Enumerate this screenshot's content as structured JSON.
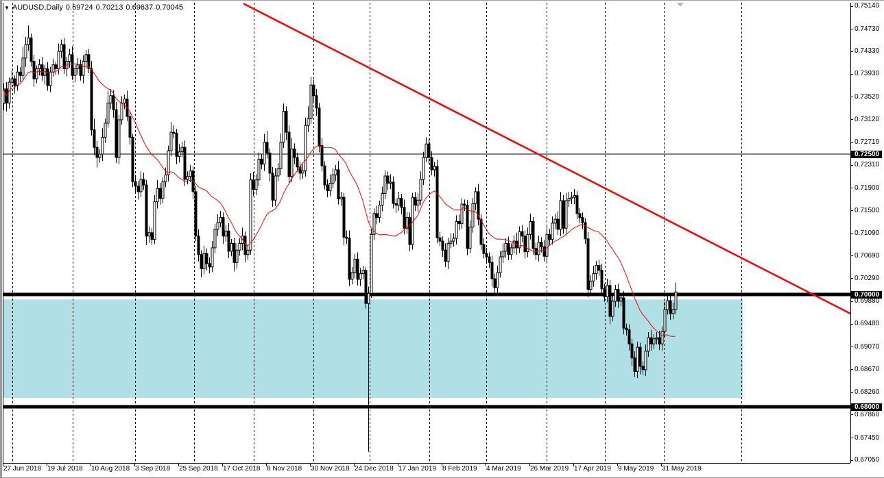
{
  "header": {
    "symbol": "AUDUSD,Daily",
    "open": "0.69724",
    "high": "0.70213",
    "low": "0.69637",
    "close": "0.70045"
  },
  "colors": {
    "bull_body": "#ffffff",
    "bear_body": "#000000",
    "moving_average": "#ff0000",
    "trendline": "#ff0000",
    "zone_fill": "#b0dfe5",
    "level_line": "#000000"
  },
  "chart_data": {
    "type": "candlestick",
    "title": "AUDUSD,Daily",
    "ylim": [
      0.6705,
      0.7514
    ],
    "price_ticks": [
      "0.75140",
      "0.74730",
      "0.74330",
      "0.73930",
      "0.73520",
      "0.73120",
      "0.72710",
      "0.72310",
      "0.71900",
      "0.71500",
      "0.71090",
      "0.70690",
      "0.70290",
      "0.69880",
      "0.69480",
      "0.69070",
      "0.68670",
      "0.68260",
      "0.67860",
      "0.67450",
      "0.67050"
    ],
    "highlighted_levels": [
      {
        "label": "0.72500",
        "price": 0.725,
        "weight": "thin"
      },
      {
        "label": "0.70000",
        "price": 0.7,
        "weight": "thick"
      },
      {
        "label": "0.68000",
        "price": 0.68,
        "weight": "thick"
      }
    ],
    "x_tick_labels": [
      "27 Jun 2018",
      "19 Jul 2018",
      "10 Aug 2018",
      "3 Sep 2018",
      "25 Sep 2018",
      "17 Oct 2018",
      "8 Nov 2018",
      "30 Nov 2018",
      "24 Dec 2018",
      "17 Jan 2019",
      "8 Feb 2019",
      "4 Mar 2019",
      "26 Mar 2019",
      "17 Apr 2019",
      "9 May 2019",
      "31 May 2019"
    ],
    "x_tick_bar_step": 16,
    "first_open": 0.734,
    "close": [
      0.7366,
      0.7341,
      0.7378,
      0.7384,
      0.7372,
      0.7396,
      0.739,
      0.7421,
      0.7445,
      0.7457,
      0.7415,
      0.7384,
      0.7402,
      0.7409,
      0.739,
      0.7402,
      0.7372,
      0.7396,
      0.7409,
      0.7402,
      0.7433,
      0.7445,
      0.7402,
      0.7415,
      0.7427,
      0.739,
      0.7402,
      0.7409,
      0.739,
      0.7415,
      0.7427,
      0.7402,
      0.7293,
      0.7262,
      0.7244,
      0.725,
      0.728,
      0.7305,
      0.7341,
      0.7354,
      0.7329,
      0.7244,
      0.7311,
      0.7341,
      0.7348,
      0.7317,
      0.728,
      0.7201,
      0.7193,
      0.7183,
      0.7205,
      0.7195,
      0.7104,
      0.711,
      0.7098,
      0.7165,
      0.7189,
      0.7171,
      0.7201,
      0.7213,
      0.7256,
      0.7289,
      0.7287,
      0.7246,
      0.7254,
      0.7262,
      0.7205,
      0.721,
      0.722,
      0.7183,
      0.7104,
      0.7071,
      0.7046,
      0.7073,
      0.7055,
      0.7049,
      0.7083,
      0.7116,
      0.7128,
      0.7137,
      0.7104,
      0.7113,
      0.7077,
      0.7091,
      0.7057,
      0.7079,
      0.7091,
      0.7104,
      0.7071,
      0.7079,
      0.7204,
      0.7187,
      0.7204,
      0.7241,
      0.7232,
      0.7271,
      0.7252,
      0.7216,
      0.7168,
      0.7211,
      0.7224,
      0.7271,
      0.7326,
      0.7289,
      0.721,
      0.7259,
      0.7244,
      0.7227,
      0.7216,
      0.722,
      0.7301,
      0.7313,
      0.7373,
      0.7354,
      0.7332,
      0.7265,
      0.7229,
      0.7195,
      0.7185,
      0.7198,
      0.7213,
      0.7222,
      0.717,
      0.7173,
      0.7102,
      0.71,
      0.7027,
      0.7039,
      0.7063,
      0.7027,
      0.7037,
      0.7043,
      0.6984,
      0.7002,
      0.7107,
      0.7144,
      0.7137,
      0.7159,
      0.718,
      0.7211,
      0.7198,
      0.72,
      0.7162,
      0.7159,
      0.7171,
      0.7155,
      0.7118,
      0.7137,
      0.7089,
      0.7173,
      0.7159,
      0.7168,
      0.7205,
      0.7244,
      0.7268,
      0.7244,
      0.7222,
      0.7228,
      0.7101,
      0.7095,
      0.7079,
      0.7059,
      0.7091,
      0.7095,
      0.71,
      0.713,
      0.7126,
      0.7161,
      0.7159,
      0.7082,
      0.712,
      0.7162,
      0.7183,
      0.7134,
      0.7089,
      0.7073,
      0.7067,
      0.7057,
      0.7028,
      0.7012,
      0.7039,
      0.7067,
      0.7077,
      0.7091,
      0.7071,
      0.7083,
      0.7095,
      0.7083,
      0.7112,
      0.7104,
      0.7076,
      0.7107,
      0.713,
      0.7082,
      0.7071,
      0.7093,
      0.7085,
      0.7068,
      0.7107,
      0.7098,
      0.7127,
      0.7134,
      0.7116,
      0.7167,
      0.7118,
      0.7167,
      0.7171,
      0.7173,
      0.7176,
      0.7144,
      0.7137,
      0.7128,
      0.7099,
      0.7009,
      0.7024,
      0.7037,
      0.7052,
      0.7043,
      0.701,
      0.6996,
      0.7016,
      0.6961,
      0.6988,
      0.7009,
      0.6988,
      0.6994,
      0.694,
      0.6937,
      0.6912,
      0.6887,
      0.6863,
      0.6906,
      0.6872,
      0.6866,
      0.6899,
      0.6923,
      0.6912,
      0.6921,
      0.6923,
      0.6912,
      0.6934,
      0.6973,
      0.6989,
      0.6966,
      0.6973,
      0.70045
    ],
    "wick_up_pips": [
      10,
      12,
      8,
      15,
      6,
      12,
      9,
      20,
      14,
      22,
      8,
      12,
      6,
      10,
      14,
      7,
      12,
      9,
      11,
      6,
      14,
      9,
      12,
      8,
      10,
      15,
      7,
      12,
      9,
      11,
      8,
      10,
      14,
      20,
      12,
      9,
      16,
      8,
      22,
      12,
      10,
      14,
      9,
      12,
      8,
      15,
      10,
      6,
      12,
      9,
      14,
      12,
      9,
      11,
      8,
      12,
      15,
      10,
      7,
      13,
      9,
      18,
      12,
      8,
      14,
      10,
      12,
      9,
      11,
      8,
      10,
      12,
      8,
      14,
      9,
      11,
      12,
      10,
      15,
      12,
      9,
      11,
      14,
      8,
      10,
      12,
      9,
      15,
      8,
      10,
      12,
      14,
      10,
      12,
      9,
      15,
      20,
      8,
      11,
      14,
      10,
      16,
      14,
      9,
      12,
      20,
      10,
      8,
      9,
      12,
      14,
      22,
      15,
      10,
      12,
      9,
      14,
      8,
      10,
      16,
      12,
      9,
      16,
      10,
      8,
      12,
      14,
      10,
      9,
      12,
      10,
      8,
      6,
      12,
      10,
      9,
      14,
      8,
      12,
      10,
      8,
      14,
      10,
      9,
      12,
      8,
      14,
      10,
      9,
      8,
      10,
      12,
      14,
      10,
      12,
      9,
      11,
      8,
      12,
      10,
      8,
      12,
      10,
      14,
      9,
      11,
      12,
      10,
      8,
      9,
      12,
      10,
      8,
      14,
      9,
      11,
      10,
      8,
      12,
      9,
      12,
      10,
      14,
      9,
      12,
      8,
      10,
      15,
      9,
      12,
      10,
      12,
      14,
      8,
      10,
      12,
      9,
      12,
      14,
      10,
      12,
      10,
      14,
      16,
      10,
      14,
      12,
      10,
      12,
      8,
      10,
      9,
      8,
      12,
      10,
      14,
      8,
      10,
      12,
      9,
      12,
      10,
      14,
      8,
      10,
      9,
      12,
      8,
      10,
      9,
      12,
      10,
      8,
      9,
      12,
      10,
      14,
      8,
      10,
      12,
      9,
      14,
      12,
      10,
      12,
      16.8
    ],
    "wick_down_pips": [
      12,
      15,
      10,
      8,
      14,
      9,
      12,
      10,
      16,
      11,
      9,
      14,
      8,
      12,
      10,
      16,
      9,
      12,
      8,
      11,
      10,
      12,
      9,
      14,
      11,
      8,
      12,
      10,
      9,
      14,
      12,
      8,
      10,
      14,
      18,
      9,
      12,
      10,
      8,
      11,
      14,
      10,
      12,
      9,
      11,
      8,
      13,
      10,
      12,
      14,
      10,
      9,
      16,
      12,
      10,
      8,
      12,
      11,
      9,
      10,
      12,
      10,
      9,
      14,
      11,
      10,
      12,
      9,
      10,
      13,
      9,
      12,
      15,
      10,
      12,
      11,
      9,
      10,
      12,
      8,
      14,
      10,
      12,
      9,
      16,
      11,
      10,
      12,
      14,
      9,
      8,
      12,
      10,
      11,
      9,
      12,
      10,
      14,
      12,
      10,
      9,
      12,
      10,
      14,
      11,
      10,
      12,
      9,
      12,
      10,
      10,
      12,
      9,
      10,
      14,
      12,
      10,
      8,
      12,
      10,
      9,
      11,
      10,
      12,
      14,
      10,
      12,
      9,
      10,
      11,
      12,
      10,
      9,
      264,
      8,
      10,
      12,
      9,
      11,
      10,
      12,
      10,
      9,
      14,
      10,
      12,
      11,
      10,
      12,
      9,
      10,
      12,
      9,
      10,
      8,
      11,
      10,
      12,
      10,
      9,
      12,
      10,
      14,
      9,
      10,
      11,
      12,
      9,
      10,
      12,
      9,
      10,
      12,
      11,
      10,
      9,
      12,
      10,
      14,
      12,
      10,
      9,
      11,
      12,
      10,
      9,
      10,
      12,
      9,
      11,
      12,
      10,
      9,
      11,
      10,
      12,
      10,
      9,
      11,
      10,
      9,
      11,
      10,
      12,
      10,
      9,
      11,
      10,
      12,
      10,
      10,
      12,
      9,
      14,
      12,
      10,
      11,
      10,
      12,
      9,
      10,
      14,
      9,
      10,
      12,
      9,
      11,
      10,
      12,
      14,
      10,
      12,
      14,
      9,
      11,
      10,
      12,
      9,
      10,
      11,
      12,
      10,
      9,
      11,
      10,
      8.7
    ],
    "moving_average_period": 20,
    "trendline": {
      "from_bar": 87.5,
      "from_price": 0.7518,
      "to_bar": 308.75,
      "to_price": 0.6966
    },
    "zone": {
      "from_bar": 0,
      "to_bar": 269.5,
      "top_price": 0.6991,
      "bottom_price": 0.6816
    }
  }
}
